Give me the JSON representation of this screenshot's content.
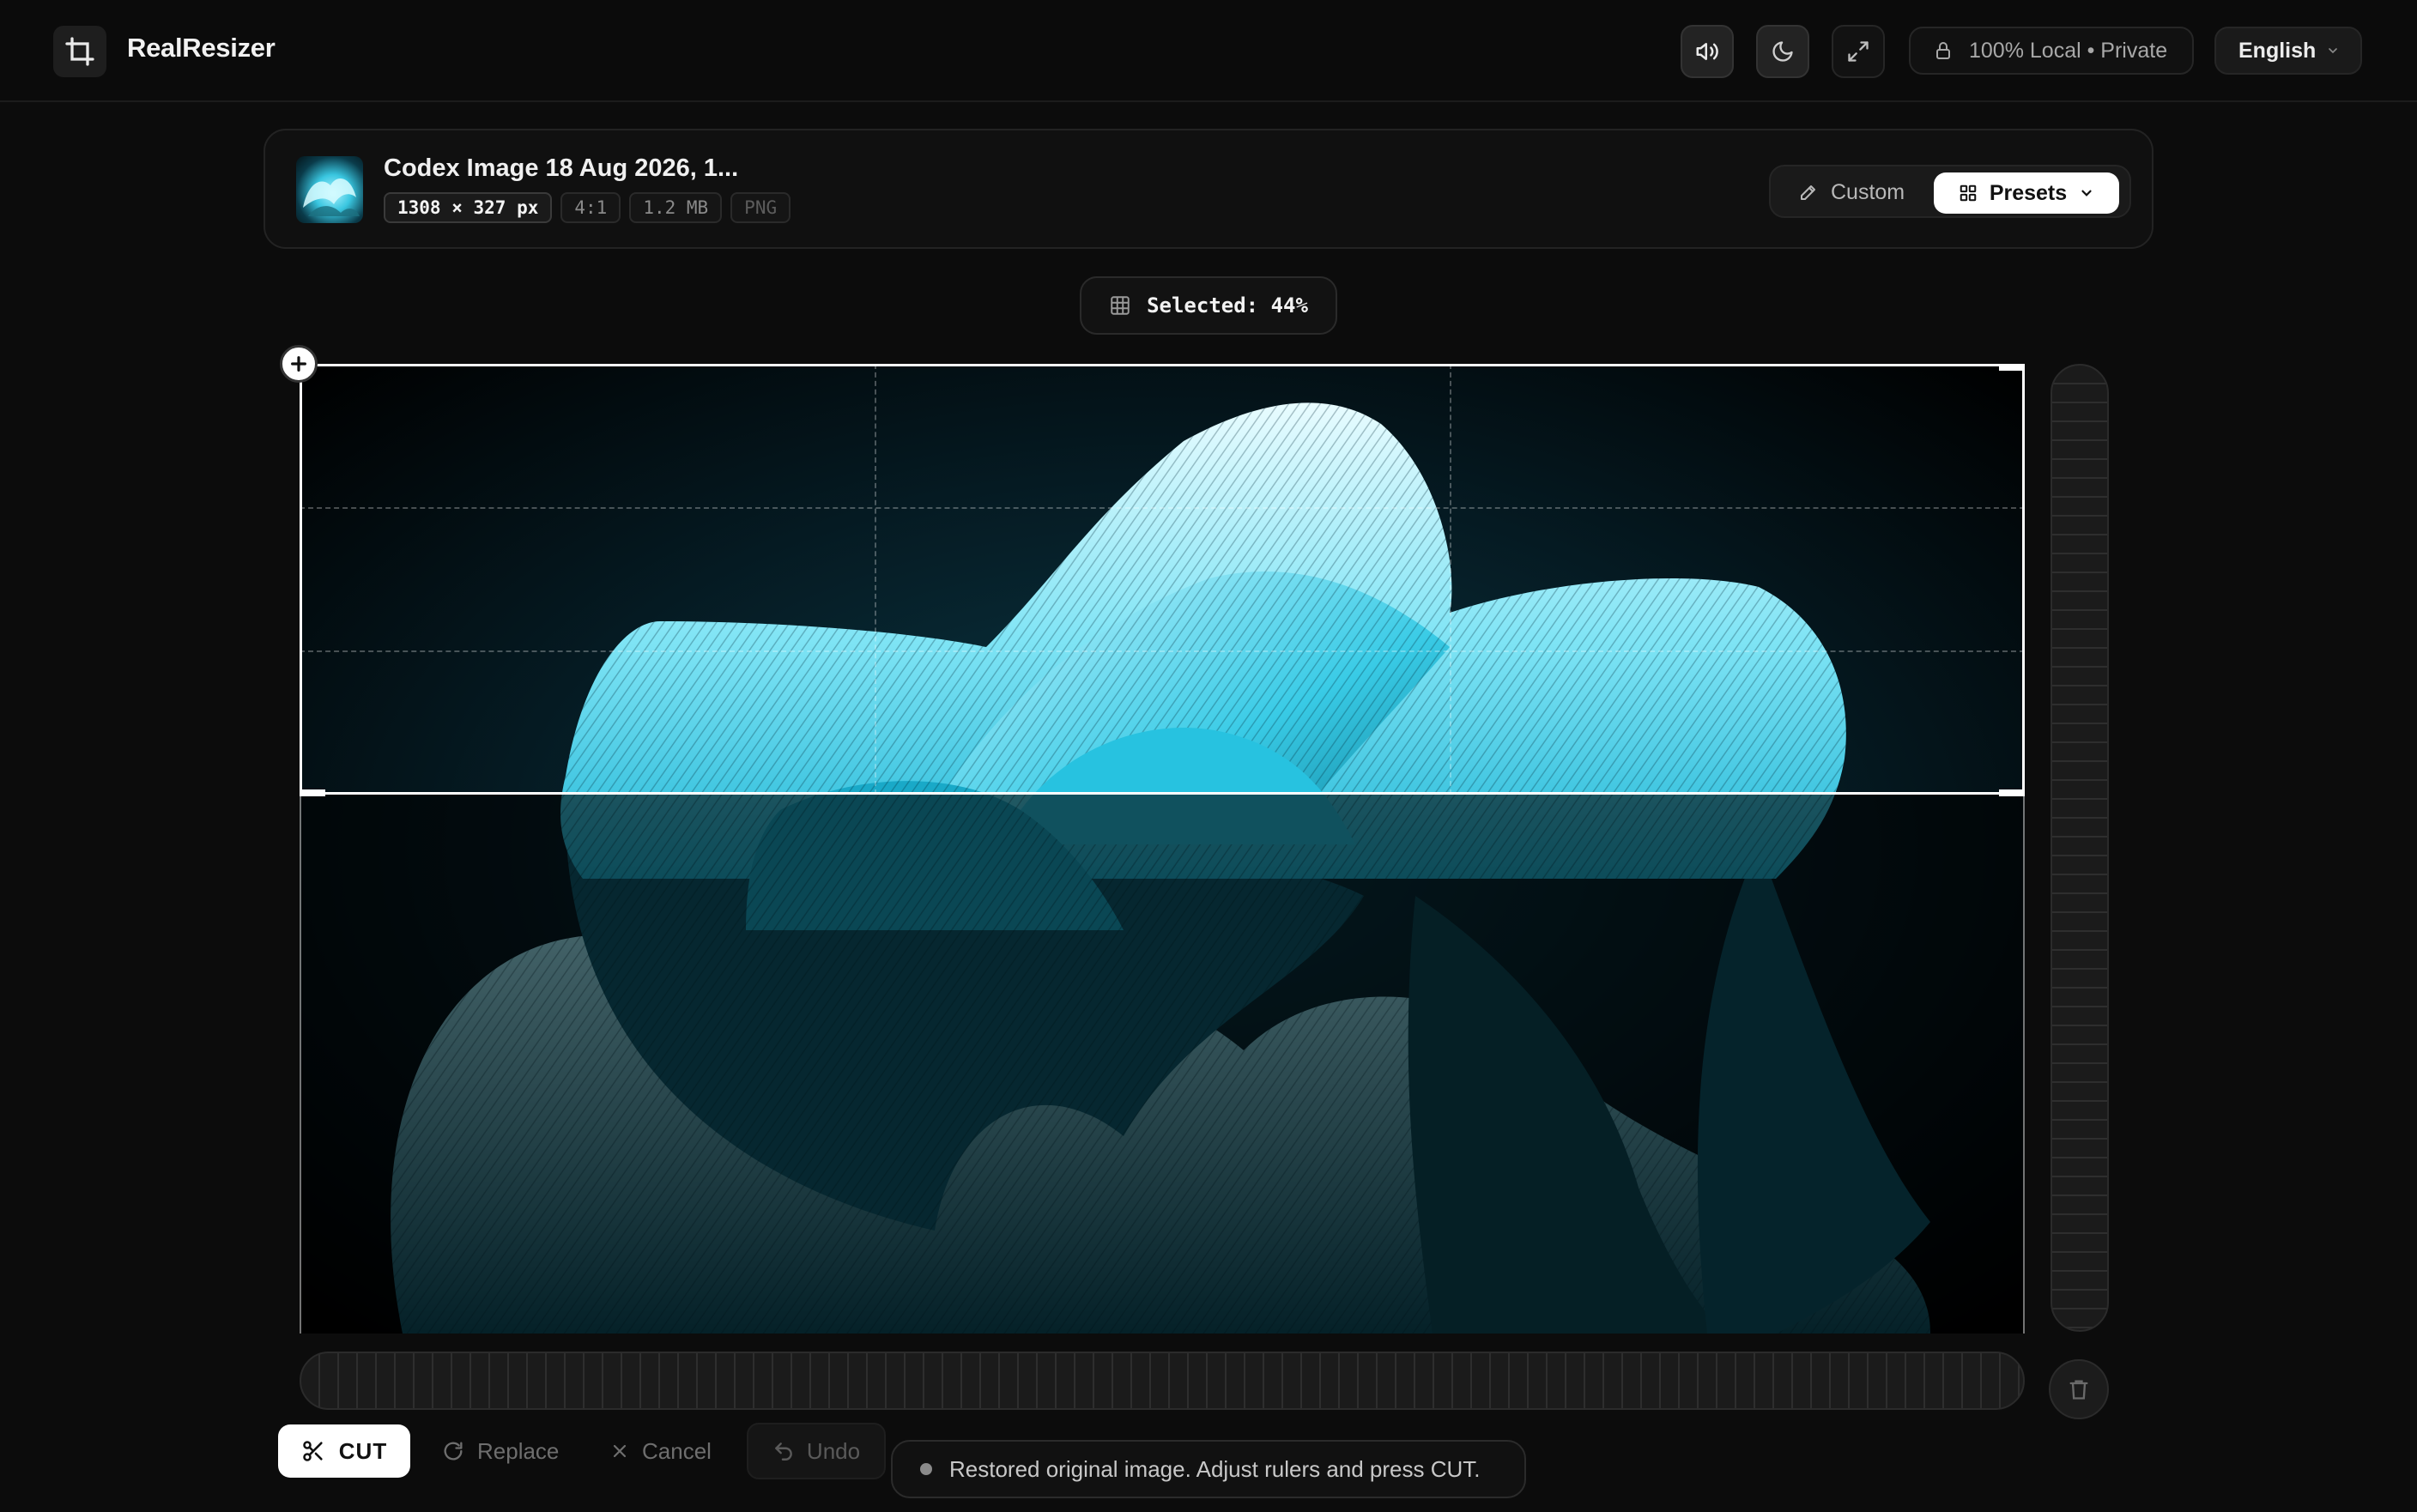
{
  "app": {
    "title": "RealResizer",
    "logo_icon": "crop-frame-icon"
  },
  "header": {
    "buttons": [
      {
        "name": "sound-toggle",
        "icon": "speaker-icon",
        "active": true
      },
      {
        "name": "theme-toggle",
        "icon": "moon-icon",
        "active": true
      },
      {
        "name": "fullscreen-toggle",
        "icon": "expand-icon",
        "active": false
      }
    ],
    "privacy_label": "100% Local • Private",
    "language": "English"
  },
  "file": {
    "name": "Codex Image 18 Aug 2026, 1...",
    "dimensions": "1308 × 327 px",
    "aspect_ratio": "4:1",
    "size": "1.2 MB",
    "format": "PNG"
  },
  "mode": {
    "custom_label": "Custom",
    "presets_label": "Presets",
    "active": "Presets"
  },
  "selection": {
    "label": "Selected: 44%",
    "fraction": 0.44
  },
  "toolbar": {
    "cut_label": "CUT",
    "replace_label": "Replace",
    "cancel_label": "Cancel",
    "undo_label": "Undo"
  },
  "status": {
    "message": "Restored original image. Adjust rulers and press CUT."
  },
  "colors": {
    "background": "#0c0c0c",
    "accent": "#ffffff",
    "art_highlight": "#5fd8ee"
  }
}
